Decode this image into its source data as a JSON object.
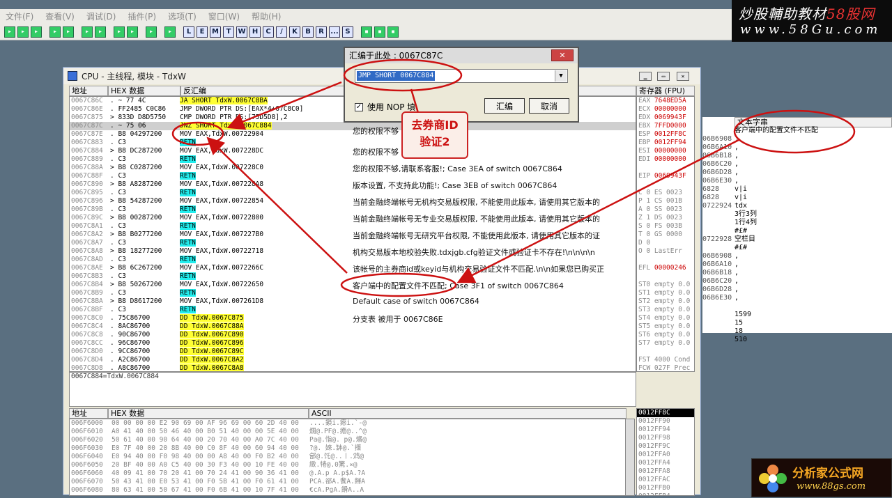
{
  "menu": [
    "文件(F)",
    "查看(V)",
    "调试(D)",
    "插件(P)",
    "选项(T)",
    "窗口(W)",
    "帮助(H)"
  ],
  "toolbar_letters": [
    "L",
    "E",
    "M",
    "T",
    "W",
    "H",
    "C",
    "/",
    "K",
    "B",
    "R",
    "...",
    "S"
  ],
  "watermark_top": {
    "line1_a": "炒股輔助教材",
    "line1_b": "58股网",
    "line2": "www.58Gu.com"
  },
  "cpu_window": {
    "title": "CPU - 主线程, 模块 - TdxW",
    "headers": {
      "addr": "地址",
      "hex": "HEX 数据",
      "disasm": "反汇编",
      "regs": "寄存器 (FPU)"
    },
    "rows": [
      {
        "a": "0067C86C",
        "h": ". ~ 77 4C",
        "d": "JA SHORT TdxW.0067C8BA",
        "c": "hl"
      },
      {
        "a": "0067C86E",
        "h": ". FF2485 C0C86",
        "d": "JMP DWORD PTR DS:[EAX*4+67C8C0]",
        "c": ""
      },
      {
        "a": "0067C875",
        "h": "> 833D D8D5750",
        "d": "CMP DWORD PTR DS:[75D5D8],2",
        "c": ""
      },
      {
        "a": "0067C87C",
        "h": ". ~ 75 06",
        "d": "JNZ SHORT TdxW.0067C884",
        "c": "hl",
        "sel": true
      },
      {
        "a": "0067C87E",
        "h": ". B8 04297200",
        "d": "MOV EAX,TdxW.00722904",
        "c": ""
      },
      {
        "a": "0067C883",
        "h": ". C3",
        "d": "RETN",
        "c": "cy"
      },
      {
        "a": "0067C884",
        "h": "> B8 DC287200",
        "d": "MOV EAX,TdxW.007228DC",
        "c": ""
      },
      {
        "a": "0067C889",
        "h": ". C3",
        "d": "RETN",
        "c": "cy"
      },
      {
        "a": "0067C88A",
        "h": "> B8 C0287200",
        "d": "MOV EAX,TdxW.007228C0",
        "c": ""
      },
      {
        "a": "0067C88F",
        "h": ". C3",
        "d": "RETN",
        "c": "cy"
      },
      {
        "a": "0067C890",
        "h": "> B8 A8287200",
        "d": "MOV EAX,TdxW.007228A8",
        "c": ""
      },
      {
        "a": "0067C895",
        "h": ". C3",
        "d": "RETN",
        "c": "cy"
      },
      {
        "a": "0067C896",
        "h": "> B8 54287200",
        "d": "MOV EAX,TdxW.00722854",
        "c": ""
      },
      {
        "a": "0067C89B",
        "h": ". C3",
        "d": "RETN",
        "c": "cy"
      },
      {
        "a": "0067C89C",
        "h": "> B8 00287200",
        "d": "MOV EAX,TdxW.00722800",
        "c": ""
      },
      {
        "a": "0067C8A1",
        "h": ". C3",
        "d": "RETN",
        "c": "cy"
      },
      {
        "a": "0067C8A2",
        "h": "> B8 B0277200",
        "d": "MOV EAX,TdxW.007227B0",
        "c": ""
      },
      {
        "a": "0067C8A7",
        "h": ". C3",
        "d": "RETN",
        "c": "cy"
      },
      {
        "a": "0067C8A8",
        "h": "> B8 18277200",
        "d": "MOV EAX,TdxW.00722718",
        "c": ""
      },
      {
        "a": "0067C8AD",
        "h": ". C3",
        "d": "RETN",
        "c": "cy"
      },
      {
        "a": "0067C8AE",
        "h": "> B8 6C267200",
        "d": "MOV EAX,TdxW.0072266C",
        "c": ""
      },
      {
        "a": "0067C8B3",
        "h": ". C3",
        "d": "RETN",
        "c": "cy"
      },
      {
        "a": "0067C8B4",
        "h": "> B8 50267200",
        "d": "MOV EAX,TdxW.00722650",
        "c": ""
      },
      {
        "a": "0067C8B9",
        "h": ". C3",
        "d": "RETN",
        "c": "cy"
      },
      {
        "a": "0067C8BA",
        "h": "> B8 D8617200",
        "d": "MOV EAX,TdxW.007261D8",
        "c": ""
      },
      {
        "a": "0067C8BF",
        "h": ". C3",
        "d": "RETN",
        "c": "cy"
      },
      {
        "a": "0067C8C0",
        "h": ". 75C86700",
        "d": "DD TdxW.0067C875",
        "c": "hl"
      },
      {
        "a": "0067C8C4",
        "h": ". 8AC86700",
        "d": "DD TdxW.0067C88A",
        "c": "hl"
      },
      {
        "a": "0067C8C8",
        "h": ". 90C86700",
        "d": "DD TdxW.0067C890",
        "c": "hl"
      },
      {
        "a": "0067C8CC",
        "h": ". 96C86700",
        "d": "DD TdxW.0067C896",
        "c": "hl"
      },
      {
        "a": "0067C8D0",
        "h": ". 9CC86700",
        "d": "DD TdxW.0067C89C",
        "c": "hl"
      },
      {
        "a": "0067C8D4",
        "h": ". A2C86700",
        "d": "DD TdxW.0067C8A2",
        "c": "hl"
      },
      {
        "a": "0067C8D8",
        "h": ". A8C86700",
        "d": "DD TdxW.0067C8A8",
        "c": "hl"
      }
    ],
    "comments": [
      "您的权限不够",
      "您的权限不够                          交易系统!",
      "您的权限不够,请联系客服!; Case 3EA of switch 0067C864",
      "版本设置, 不支持此功能!; Case 3EB of switch 0067C864",
      "当前金融终端帐号无机构交易版权限, 不能使用此版本, 请使用其它版本的",
      "当前金融终端帐号无专业交易版权限, 不能使用此版本, 请使用其它版本的",
      "当前金融终端帐号无研究平台权限, 不能使用此版本, 请使用其它版本的证",
      "机构交易版本地校验失败.tdxjgb.cfg验证文件或验证卡不存在!\\n\\n\\n\\n",
      "该帐号的主券商id或keyid与机构交易验证文件不匹配.\\n\\n如果您已购买正",
      "客户端中的配置文件不匹配; Case 3F1 of switch 0067C864",
      "Default case of switch 0067C864",
      "分支表 被用于 0067C86E"
    ],
    "status_line": "0067C884=TdxW.0067C884",
    "registers": [
      {
        "n": "EAX",
        "v": "7648ED5A"
      },
      {
        "n": "ECX",
        "v": "00000000"
      },
      {
        "n": "EDX",
        "v": "0069943F"
      },
      {
        "n": "EBX",
        "v": "7FFD0000"
      },
      {
        "n": "ESP",
        "v": "0012FF8C"
      },
      {
        "n": "EBP",
        "v": "0012FF94"
      },
      {
        "n": "ESI",
        "v": "00000000"
      },
      {
        "n": "EDI",
        "v": "00000000"
      },
      {
        "n": "",
        "v": ""
      },
      {
        "n": "EIP",
        "v": "0069943F"
      }
    ],
    "flags": [
      "C 0  ES 0023",
      "P 1  CS 001B",
      "A 0  SS 0023",
      "Z 1  DS 0023",
      "S 0  FS 003B",
      "T 0  GS 0000",
      "D 0",
      "O 0  LastErr"
    ],
    "efl": "00000246",
    "fpu": [
      "ST0 empty 0.0",
      "ST1 empty 0.0",
      "ST2 empty 0.0",
      "ST3 empty 0.0",
      "ST4 empty 0.0",
      "ST5 empty 0.0",
      "ST6 empty 0.0",
      "ST7 empty 0.0"
    ],
    "fst": "FST 4000  Cond",
    "fcw": "FCW 027F  Prec",
    "dump_headers": {
      "addr": "地址",
      "hex": "HEX 数据",
      "ascii": "ASCII"
    },
    "dump": [
      {
        "a": "006F6000",
        "x": "00 00 00 00 E2 90 69 00 AF 96 69 00 60 2D 40 00",
        "s": "....鎖i.瘱i.`-@"
      },
      {
        "a": "006F6010",
        "x": "A0 41 40 00 50 46 40 00 B0 51 40 00 00 5E 40 00",
        "s": "燗@.PF@.癚@..^@"
      },
      {
        "a": "006F6020",
        "x": "50 61 40 00 90 64 40 00 20 70 40 00 A0 7C 40 00",
        "s": "Pa@.恉@. p@.爘@"
      },
      {
        "a": "006F6030",
        "x": "E0 7F 40 00 20 8B 40 00 C0 8F 40 00 60 94 40 00",
        "s": "?@. 婡.缽@.`擛"
      },
      {
        "a": "006F6040",
        "x": "E0 94 40 00 F0 98 40 00 00 A8 40 00 F0 B2 40 00",
        "s": "鄶@.饦@..〡.鸩@"
      },
      {
        "a": "006F6050",
        "x": "20 BF 40 00 A0 C5 40 00 30 F3 40 00 10 FE 40 00",
        "s": " 緻.犈@.0驚.∝@"
      },
      {
        "a": "006F6060",
        "x": "40 09 41 00 70 20 41 00 70 24 41 00 90 36 41 00",
        "s": "@.A.p A.p$A.?A"
      },
      {
        "a": "006F6070",
        "x": "50 43 41 00 E0 53 41 00 F0 5B 41 00 F0 61 41 00",
        "s": "PCA.郤A.餥A.餫A"
      },
      {
        "a": "006F6080",
        "x": "80 63 41 00 50 67 41 00 F0 6B 41 00 10 7F 41 00",
        "s": "€cA.PgA.餶A..A"
      }
    ],
    "stack": [
      "0012FF8C",
      "0012FF90",
      "0012FF94",
      "0012FF98",
      "0012FF9C",
      "0012FFA0",
      "0012FFA4",
      "0012FFA8",
      "0012FFAC",
      "0012FFB0",
      "0012FFB4"
    ]
  },
  "right_panel": {
    "header": "文本字串",
    "rows": [
      {
        "l": "",
        "t": "客户端中的配置文件不匹配"
      },
      {
        "l": "06B6908",
        "t": ","
      },
      {
        "l": "06B6A10",
        "t": ","
      },
      {
        "l": "06B6B18",
        "t": ","
      },
      {
        "l": "06B6C20",
        "t": ","
      },
      {
        "l": "06B6D28",
        "t": ","
      },
      {
        "l": "06B6E30",
        "t": ","
      },
      {
        "l": "6828",
        "t": "v|i"
      },
      {
        "l": "6828",
        "t": "v|i"
      },
      {
        "l": "0722924",
        "t": "tdx"
      },
      {
        "l": "",
        "t": "3行3列"
      },
      {
        "l": "",
        "t": "1行4列"
      },
      {
        "l": "",
        "t": "#£#"
      },
      {
        "l": "0722928",
        "t": "空栏目"
      },
      {
        "l": "",
        "t": "#£#"
      },
      {
        "l": "06B6908",
        "t": ","
      },
      {
        "l": "06B6A10",
        "t": ","
      },
      {
        "l": "06B6B18",
        "t": ","
      },
      {
        "l": "06B6C20",
        "t": ","
      },
      {
        "l": "06B6D28",
        "t": ","
      },
      {
        "l": "06B6E30",
        "t": ","
      },
      {
        "l": "",
        "t": ""
      },
      {
        "l": "",
        "t": "1599"
      },
      {
        "l": "",
        "t": "15"
      },
      {
        "l": "",
        "t": "18"
      },
      {
        "l": "",
        "t": "510"
      }
    ]
  },
  "dialog": {
    "title": "汇编于此处 : 0067C87C",
    "close": "✕",
    "input_value": "JMP SHORT 0067C884",
    "checkbox_label": "使用 NOP 填",
    "checkbox_mark": "✓",
    "assemble": "汇编",
    "cancel": "取消"
  },
  "callout": {
    "line1": "去券商ID",
    "line2": "验证2"
  },
  "logo_bottom": {
    "title": "分析家公式网",
    "url": "www.88gs.com"
  },
  "colors": {
    "annotation": "#cc1111",
    "highlight": "#ffff33",
    "retn": "#22eeee"
  }
}
